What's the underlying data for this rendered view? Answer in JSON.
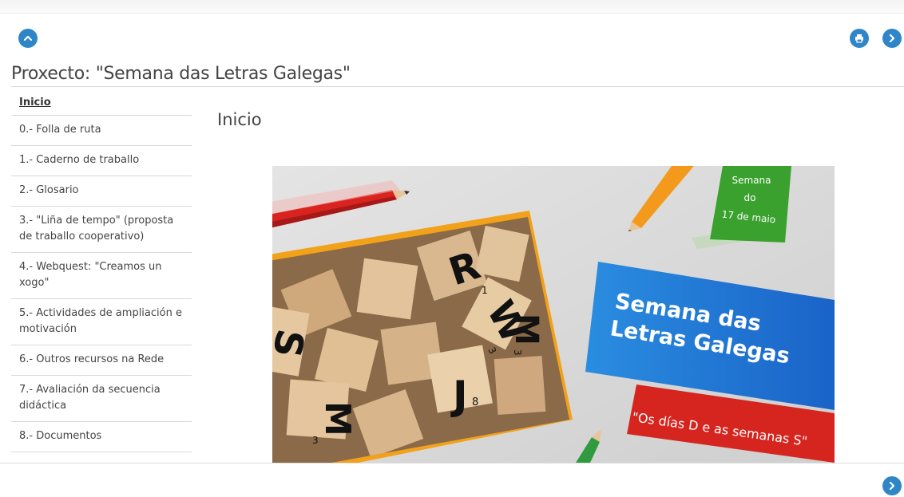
{
  "page": {
    "title": "Proxecto: \"Semana das Letras Galegas\"",
    "content_title": "Inicio"
  },
  "icons": {
    "collapse": "chevron-up-icon",
    "print": "print-icon",
    "next": "chevron-right-icon",
    "accent_color": "#2e86c9"
  },
  "nav": {
    "items": [
      {
        "label": "Inicio",
        "active": true
      },
      {
        "label": "0.- Folla de ruta"
      },
      {
        "label": "1.- Caderno de traballo"
      },
      {
        "label": "2.- Glosario"
      },
      {
        "label": "3.- \"Liña de tempo\" (proposta de traballo cooperativo)"
      },
      {
        "label": "4.- Webquest: \"Creamos un xogo\""
      },
      {
        "label": "5.- Actividades de ampliación e motivación"
      },
      {
        "label": "6.- Outros recursos na Rede"
      },
      {
        "label": "7.- Avaliación da secuencia didáctica"
      },
      {
        "label": "8.- Documentos"
      }
    ]
  },
  "banner": {
    "tag_line1": "Semana",
    "tag_line2": "do",
    "tag_line3": "17 de maio",
    "headline_line1": "Semana das",
    "headline_line2": "Letras Galegas",
    "subtitle": "\"Os días D e as semanas S\"",
    "tiles": [
      {
        "letter": "R",
        "num": "1"
      },
      {
        "letter": "W",
        "num": "3"
      },
      {
        "letter": "M",
        "num": "3"
      },
      {
        "letter": "J",
        "num": "8"
      },
      {
        "letter": "S",
        "num": ""
      },
      {
        "letter": "M",
        "num": "3"
      }
    ]
  }
}
